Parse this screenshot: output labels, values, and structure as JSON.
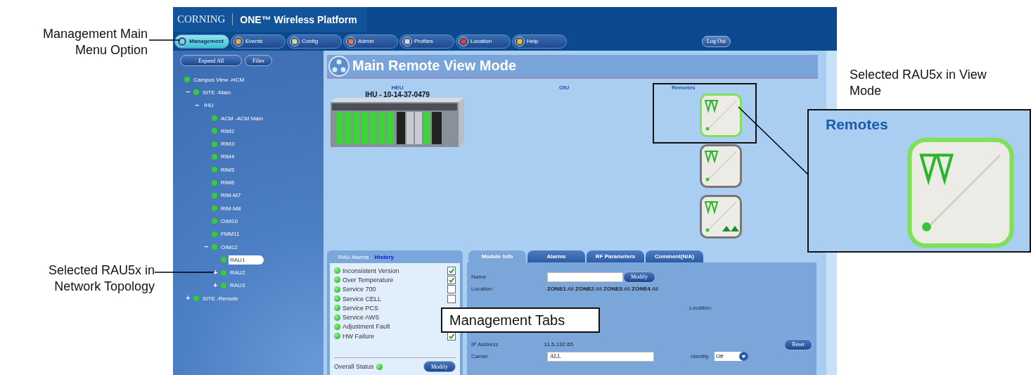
{
  "annotations": {
    "menu_option": "Management Main Menu Option",
    "topology": "Selected RAU5x in Network Topology",
    "view_mode": "Selected RAU5x in View Mode",
    "tabs": "Management Tabs",
    "zoom_title": "Remotes"
  },
  "header": {
    "brand": "CORNING",
    "product": "ONE™ Wireless Platform"
  },
  "menu": [
    {
      "label": "Management",
      "selected": true
    },
    {
      "label": "Events",
      "selected": false
    },
    {
      "label": "Config",
      "selected": false
    },
    {
      "label": "Admin",
      "selected": false
    },
    {
      "label": "Profiles",
      "selected": false
    },
    {
      "label": "Location",
      "selected": false
    },
    {
      "label": "Help",
      "selected": false
    }
  ],
  "logout": "Log Out",
  "sidebar": {
    "buttons": [
      "Expand All",
      "Filter"
    ],
    "tree": [
      {
        "label": "Campus View -HCM",
        "status_dot": true,
        "selected": false,
        "children": [
          {
            "label": "SITE -Main",
            "toggle": "−",
            "status_dot": true,
            "selected": false,
            "children": [
              {
                "label": "IHU",
                "toggle": "−",
                "status_dot": false,
                "selected": false,
                "children": [
                  {
                    "label": "ACM -ACM Main",
                    "status_dot": true,
                    "selected": false
                  },
                  {
                    "label": "RIM2",
                    "status_dot": true,
                    "selected": false
                  },
                  {
                    "label": "RIM3",
                    "status_dot": true,
                    "selected": false
                  },
                  {
                    "label": "RIM4",
                    "status_dot": true,
                    "selected": false
                  },
                  {
                    "label": "RIM5",
                    "status_dot": true,
                    "selected": false
                  },
                  {
                    "label": "RIM6",
                    "status_dot": true,
                    "selected": false
                  },
                  {
                    "label": "RIM-M7",
                    "status_dot": true,
                    "selected": false
                  },
                  {
                    "label": "RIM-M8",
                    "status_dot": true,
                    "selected": false
                  },
                  {
                    "label": "OIM10",
                    "status_dot": true,
                    "selected": false
                  },
                  {
                    "label": "FMM11",
                    "status_dot": true,
                    "selected": false
                  },
                  {
                    "label": "OIM12",
                    "toggle": "−",
                    "status_dot": true,
                    "selected": false,
                    "children": [
                      {
                        "label": "RAU1",
                        "status_dot": true,
                        "selected": true
                      },
                      {
                        "label": "RAU2",
                        "toggle": "+",
                        "status_dot": true,
                        "selected": false
                      },
                      {
                        "label": "RAU3",
                        "toggle": "+",
                        "status_dot": true,
                        "selected": false
                      }
                    ]
                  }
                ]
              }
            ]
          },
          {
            "label": "SITE -Remote",
            "toggle": "+",
            "status_dot": true,
            "selected": false
          }
        ]
      }
    ]
  },
  "main": {
    "title": "Main Remote View Mode",
    "columns": [
      "HEU",
      "OIU",
      "Remotes"
    ],
    "chassis_label": "IHU - 10-14-37-0479",
    "remotes": [
      {
        "kind": "standard",
        "selected": true
      },
      {
        "kind": "standard",
        "selected": false
      },
      {
        "kind": "ports",
        "selected": false
      }
    ]
  },
  "alarms": {
    "title": "RAU Alarms -",
    "link": "History",
    "items": [
      {
        "label": "Inconsistent Version",
        "checked": true
      },
      {
        "label": "Over Temperature",
        "checked": true
      },
      {
        "label": "Service 700",
        "checked": false
      },
      {
        "label": "Service CELL",
        "checked": false
      },
      {
        "label": "Service PCS"
      },
      {
        "label": "Service AWS"
      },
      {
        "label": "Adjustment Fault"
      },
      {
        "label": "HW Failure",
        "checked": true
      }
    ],
    "overall_label": "Overall Status",
    "modify": "Modify"
  },
  "module": {
    "tabs": [
      {
        "label": "Module Info",
        "selected": true
      },
      {
        "label": "Alarms",
        "selected": false
      },
      {
        "label": "RF Parameters",
        "selected": false
      },
      {
        "label": "Comment(N/A)",
        "selected": false
      }
    ],
    "name_label": "Name",
    "modify": "Modify",
    "location_label": "Location",
    "location_value": "**ZONE1**:All **ZONE2**:All **ZONE3**:All **ZONE4**:All",
    "location2_label": "Location:",
    "ip_label": "IP Address",
    "ip_value": "11.5.132.65",
    "reset": "Reset",
    "carrier_label": "Carrier",
    "carrier_value": "ALL",
    "identify_label": "Identify",
    "identify_value": "Off"
  }
}
